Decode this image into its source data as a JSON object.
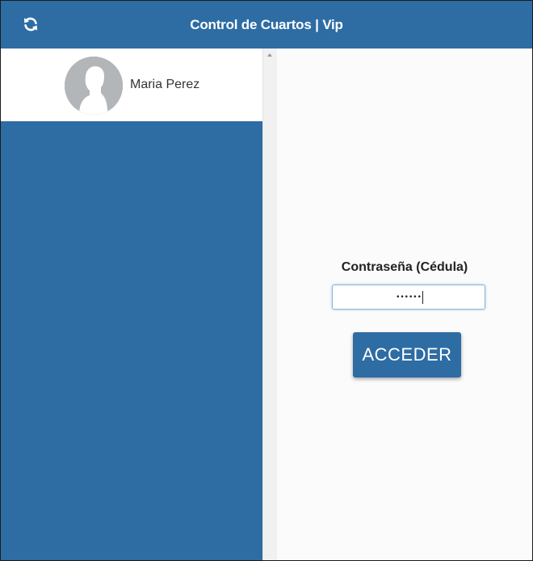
{
  "header": {
    "title": "Control de Cuartos | Vip",
    "refresh_icon": "refresh-icon"
  },
  "sidebar": {
    "users": [
      {
        "name": "Maria Perez",
        "avatar_icon": "default-avatar-icon"
      }
    ]
  },
  "login": {
    "label": "Contraseña (Cédula)",
    "password_value": "••••••",
    "submit_label": "ACCEDER"
  },
  "colors": {
    "primary": "#2e6ca4",
    "background": "#fbfbfb"
  }
}
